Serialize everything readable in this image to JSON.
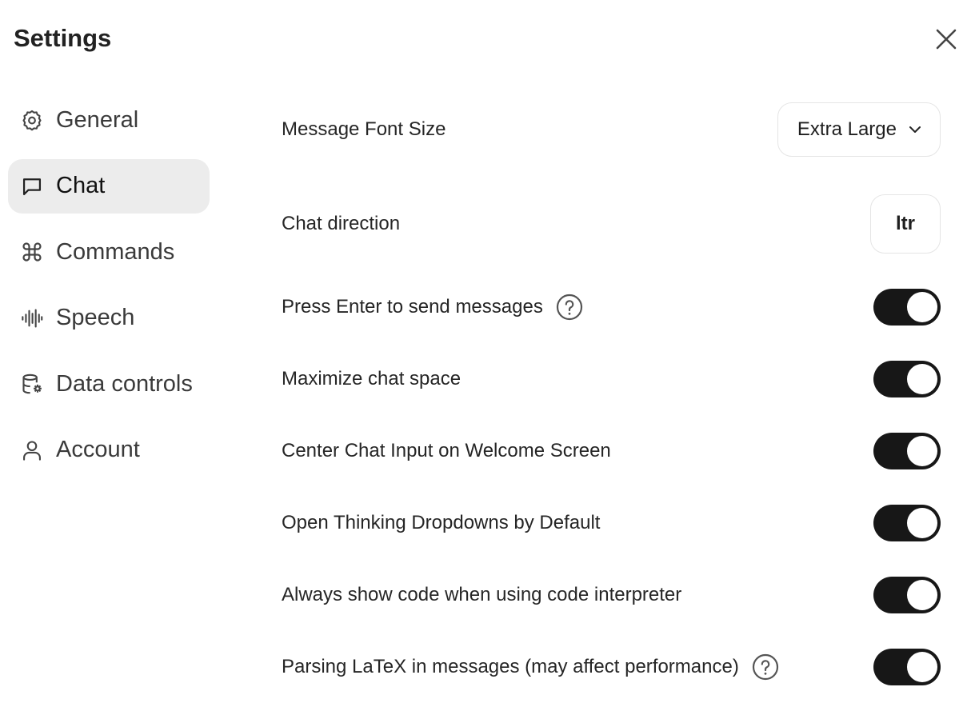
{
  "header": {
    "title": "Settings"
  },
  "sidebar": {
    "items": [
      {
        "label": "General",
        "icon": "gear-icon",
        "active": false
      },
      {
        "label": "Chat",
        "icon": "chat-bubble-icon",
        "active": true
      },
      {
        "label": "Commands",
        "icon": "command-icon",
        "active": false
      },
      {
        "label": "Speech",
        "icon": "audio-waveform-icon",
        "active": false
      },
      {
        "label": "Data controls",
        "icon": "database-settings-icon",
        "active": false
      },
      {
        "label": "Account",
        "icon": "user-icon",
        "active": false
      }
    ]
  },
  "chat": {
    "font_size": {
      "label": "Message Font Size",
      "value": "Extra Large"
    },
    "direction": {
      "label": "Chat direction",
      "value": "ltr"
    },
    "toggles": [
      {
        "label": "Press Enter to send messages",
        "on": true,
        "help": true
      },
      {
        "label": "Maximize chat space",
        "on": true,
        "help": false
      },
      {
        "label": "Center Chat Input on Welcome Screen",
        "on": true,
        "help": false
      },
      {
        "label": "Open Thinking Dropdowns by Default",
        "on": true,
        "help": false
      },
      {
        "label": "Always show code when using code interpreter",
        "on": true,
        "help": false
      },
      {
        "label": "Parsing LaTeX in messages (may affect performance)",
        "on": true,
        "help": true
      }
    ]
  }
}
